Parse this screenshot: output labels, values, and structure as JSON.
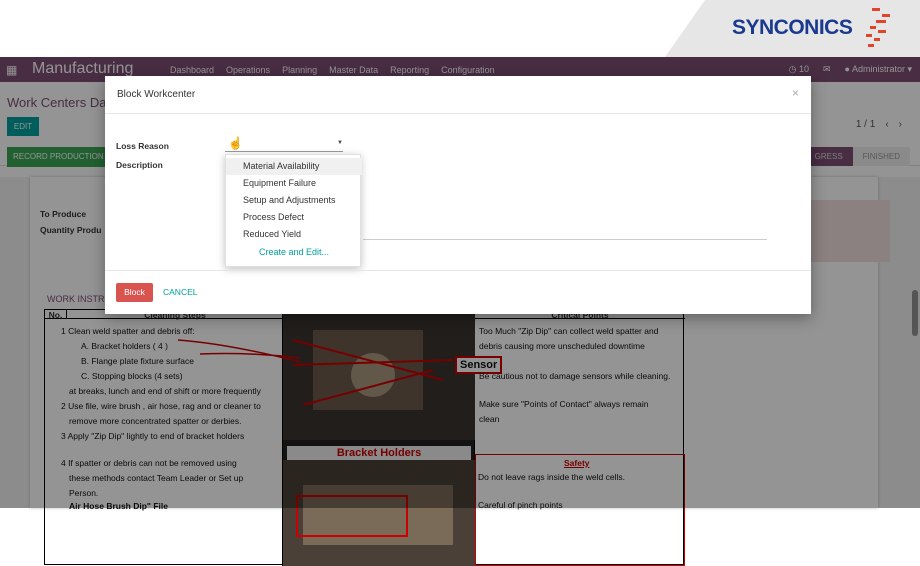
{
  "brand": {
    "logo_text": "SYNCONICS",
    "logo_color": "#1a3a8f",
    "accent": "#e0452b"
  },
  "topnav": {
    "app_name": "Manufacturing",
    "menu": [
      "Dashboard",
      "Operations",
      "Planning",
      "Master Data",
      "Reporting",
      "Configuration"
    ],
    "notifications": "10",
    "user": "Administrator"
  },
  "control_panel": {
    "breadcrumb": "Work Centers Da",
    "edit_label": "EDIT",
    "pager": "1 / 1",
    "record_production": "RECORD PRODUCTION",
    "stages": [
      "GRESS",
      "FINISHED"
    ]
  },
  "sheet": {
    "to_produce_label": "To Produce",
    "quantity_label": "Quantity Produ",
    "work_instructions": "WORK INSTR",
    "table": {
      "headers": [
        "No.",
        "Cleaning Steps",
        "Critical Points"
      ],
      "steps": [
        "1  Clean weld spatter and debris off:",
        "A. Bracket holders ( 4 )",
        "B. Flange plate fixture surface",
        "C. Stopping blocks (4 sets)",
        "at breaks, lunch and end of shift or more frequently",
        "2  Use file, wire brush , air hose, rag and or cleaner to",
        "remove more concentrated spatter or derbies.",
        "3  Apply \"Zip Dip\" lightly to end of bracket holders",
        "4  If spatter or debris can not be removed using",
        "these methods contact Team Leader or Set up",
        "Person.",
        "Air Hose  Brush  Dip\"  File"
      ],
      "photo_label": "Sensor",
      "photo_band": "Bracket Holders",
      "critical": [
        "Too Much \"Zip Dip\" can collect weld spatter and",
        "debris causing more unscheduled downtime",
        "Be cautious not to damage sensors while cleaning.",
        "Make sure \"Points of Contact\" always remain",
        "clean"
      ],
      "safety_title": "Safety",
      "safety_items": [
        "Do not leave rags inside the weld cells.",
        "Careful of pinch points"
      ]
    }
  },
  "modal": {
    "title": "Block Workcenter",
    "close": "×",
    "loss_reason_label": "Loss Reason",
    "description_label": "Description",
    "options": [
      "Material Availability",
      "Equipment Failure",
      "Setup and Adjustments",
      "Process Defect",
      "Reduced Yield"
    ],
    "create_edit": "Create and Edit...",
    "block_label": "Block",
    "cancel_label": "CANCEL"
  }
}
